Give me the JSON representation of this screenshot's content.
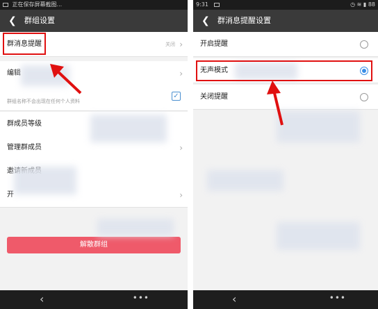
{
  "left_screen": {
    "status_text": "正在保存屏幕截图...",
    "header": {
      "title": "群组设置"
    },
    "rows": [
      {
        "label": "群消息提醒",
        "value": "关闭"
      },
      {
        "label": "编辑",
        "value": ""
      },
      {
        "label": "群成员等级",
        "value": ""
      },
      {
        "label": "管理群成员",
        "value": ""
      },
      {
        "label": "邀请新成员",
        "value": ""
      },
      {
        "label": "开",
        "value": ""
      }
    ],
    "description": "群组名称不会出现在任何个人资料",
    "disband_button": "解散群组",
    "check_mark": "✓"
  },
  "right_screen": {
    "status_time": "9:31",
    "status_battery": "88",
    "header": {
      "title": "群消息提醒设置"
    },
    "options": [
      {
        "label": "开启提醒",
        "selected": false
      },
      {
        "label": "无声模式",
        "selected": true
      },
      {
        "label": "关闭提醒",
        "selected": false
      }
    ]
  },
  "nav": {
    "back_glyph": "‹",
    "menu_glyph": "•••"
  },
  "colors": {
    "highlight": "#e01010",
    "accent": "#3a8ee6",
    "disband": "#ef5a6a",
    "header": "#3a3a3a"
  }
}
